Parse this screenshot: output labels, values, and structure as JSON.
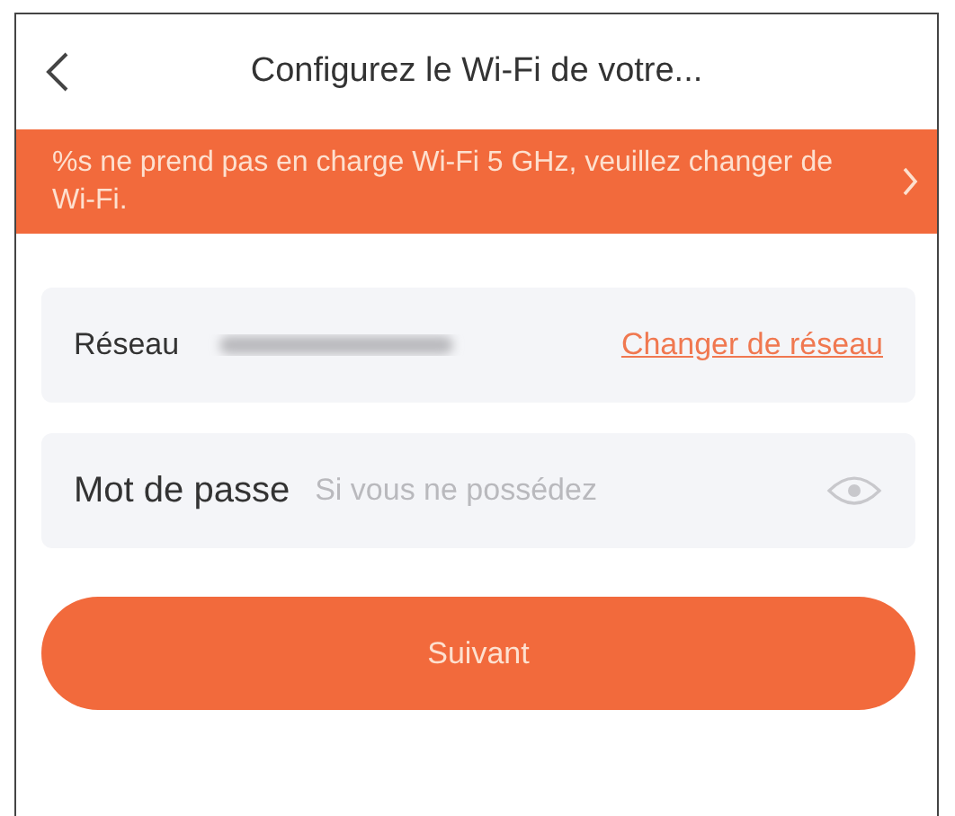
{
  "header": {
    "title": "Configurez le Wi-Fi de votre..."
  },
  "banner": {
    "text": "%s ne prend pas en charge Wi-Fi 5 GHz, veuillez changer de Wi-Fi."
  },
  "network": {
    "label": "Réseau",
    "link": "Changer de réseau"
  },
  "password": {
    "label": "Mot de passe",
    "placeholder": "Si vous ne possédez"
  },
  "button": {
    "label": "Suivant"
  }
}
